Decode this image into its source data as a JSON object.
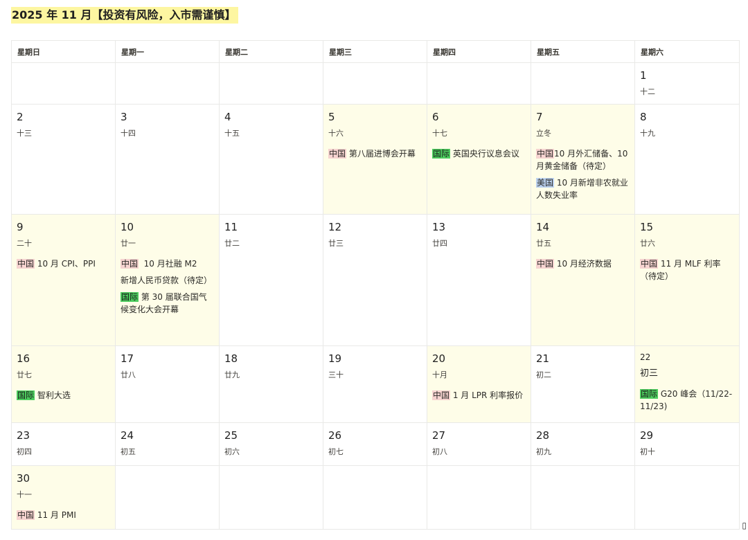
{
  "title": "2025 年 11 月【投资有风险，入市需谨慎】",
  "weekdays": [
    "星期日",
    "星期一",
    "星期二",
    "星期三",
    "星期四",
    "星期五",
    "星期六"
  ],
  "tags": {
    "cn": "中国",
    "intl": "国际",
    "us": "美国"
  },
  "colors": {
    "title_highlight": "#fdf6a1",
    "tag_cn": "#f6d3d0",
    "tag_intl": "#4ccd5e",
    "tag_us": "#bcd2f0",
    "weekend_bg": "#fefde8"
  },
  "days": {
    "d1": {
      "num": "1",
      "lunar": "十二"
    },
    "d2": {
      "num": "2",
      "lunar": "十三"
    },
    "d3": {
      "num": "3",
      "lunar": "十四"
    },
    "d4": {
      "num": "4",
      "lunar": "十五"
    },
    "d5": {
      "num": "5",
      "lunar": "十六",
      "events": [
        "第八届进博会开幕"
      ]
    },
    "d6": {
      "num": "6",
      "lunar": "十七",
      "events": [
        "英国央行议息会议"
      ]
    },
    "d7": {
      "num": "7",
      "lunar": "立冬",
      "events": [
        "10 月外汇储备、10 月黄金储备（待定）",
        "10 月新增非农就业人数失业率"
      ]
    },
    "d8": {
      "num": "8",
      "lunar": "十九"
    },
    "d9": {
      "num": "9",
      "lunar": "二十",
      "events": [
        "10 月 CPI、PPI"
      ]
    },
    "d10": {
      "num": "10",
      "lunar": "廿一",
      "events": [
        "10 月社融 M2",
        "新增人民币贷款（待定）",
        "第 30 届联合国气候变化大会开幕"
      ]
    },
    "d11": {
      "num": "11",
      "lunar": "廿二"
    },
    "d12": {
      "num": "12",
      "lunar": "廿三"
    },
    "d13": {
      "num": "13",
      "lunar": "廿四"
    },
    "d14": {
      "num": "14",
      "lunar": "廿五",
      "events": [
        "10 月经济数据"
      ]
    },
    "d15": {
      "num": "15",
      "lunar": "廿六",
      "events": [
        "11 月 MLF 利率（待定）"
      ]
    },
    "d16": {
      "num": "16",
      "lunar": "廿七",
      "events": [
        "智利大选"
      ]
    },
    "d17": {
      "num": "17",
      "lunar": "廿八"
    },
    "d18": {
      "num": "18",
      "lunar": "廿九"
    },
    "d19": {
      "num": "19",
      "lunar": "三十"
    },
    "d20": {
      "num": "20",
      "lunar": "十月",
      "events": [
        "1 月 LPR 利率报价"
      ]
    },
    "d21": {
      "num": "21",
      "lunar": "初二"
    },
    "d22": {
      "num": "22",
      "lunar": "初三",
      "events": [
        "G20 峰会（11/22-11/23)"
      ]
    },
    "d23": {
      "num": "23",
      "lunar": "初四"
    },
    "d24": {
      "num": "24",
      "lunar": "初五"
    },
    "d25": {
      "num": "25",
      "lunar": "初六"
    },
    "d26": {
      "num": "26",
      "lunar": "初七"
    },
    "d27": {
      "num": "27",
      "lunar": "初八"
    },
    "d28": {
      "num": "28",
      "lunar": "初九"
    },
    "d29": {
      "num": "29",
      "lunar": "初十"
    },
    "d30": {
      "num": "30",
      "lunar": "十一",
      "events": [
        "11 月 PMI"
      ]
    }
  }
}
